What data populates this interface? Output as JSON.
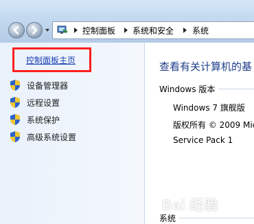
{
  "address": {
    "crumbs": [
      "控制面板",
      "系统和安全",
      "系统"
    ]
  },
  "left_pane": {
    "home_link": "控制面板主页",
    "tasks": [
      {
        "label": "设备管理器",
        "icon": "uac-shield-icon"
      },
      {
        "label": "远程设置",
        "icon": "uac-shield-icon"
      },
      {
        "label": "系统保护",
        "icon": "uac-shield-icon"
      },
      {
        "label": "高级系统设置",
        "icon": "uac-shield-icon"
      }
    ]
  },
  "main": {
    "heading": "查看有关计算机的基",
    "windows_section": {
      "title": "Windows 版本",
      "edition": "Windows 7 旗舰版",
      "copyright": "版权所有 © 2009 Mic",
      "service_pack": "Service Pack 1"
    },
    "system_section": {
      "title": "系统"
    }
  },
  "watermark": "Bai 经验",
  "colors": {
    "link": "#1a3fb0",
    "heading": "#1e3d8a",
    "highlight": "#ff1f1f",
    "toolbar": "#c3d9ef"
  }
}
